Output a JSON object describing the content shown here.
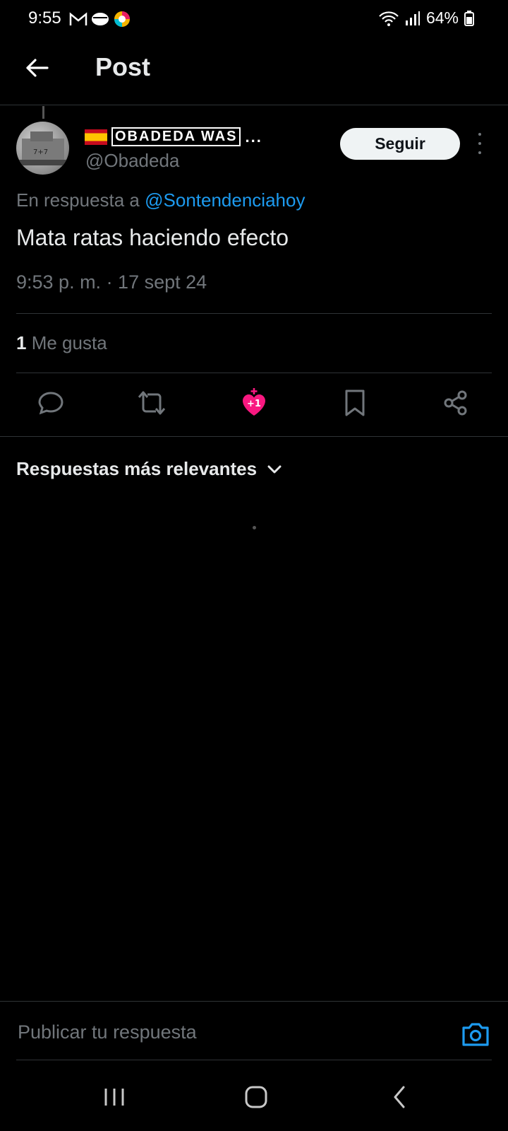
{
  "status_bar": {
    "time": "9:55",
    "battery": "64%"
  },
  "header": {
    "title": "Post"
  },
  "post": {
    "author_name_flag_alt": "🇪🇸",
    "author_name": "OBADEDA WAS",
    "author_name_ellipsis": "...",
    "handle": "@Obadeda",
    "follow_label": "Seguir",
    "reply_prefix": "En respuesta a",
    "reply_to": "@Sontendenciahoy",
    "text": "Mata ratas haciendo efecto",
    "timestamp": "9:53 p. m. · 17 sept 24",
    "likes_count": "1",
    "likes_label": "Me gusta"
  },
  "actions": {
    "icons": [
      "reply-icon",
      "retweet-icon",
      "like-icon",
      "bookmark-icon",
      "share-icon"
    ],
    "like_badge": "+1"
  },
  "replies": {
    "sort_label": "Respuestas más relevantes"
  },
  "composer": {
    "placeholder": "Publicar tu respuesta"
  },
  "colors": {
    "accent": "#1d9bf0",
    "like": "#f91880",
    "background": "#000000"
  }
}
